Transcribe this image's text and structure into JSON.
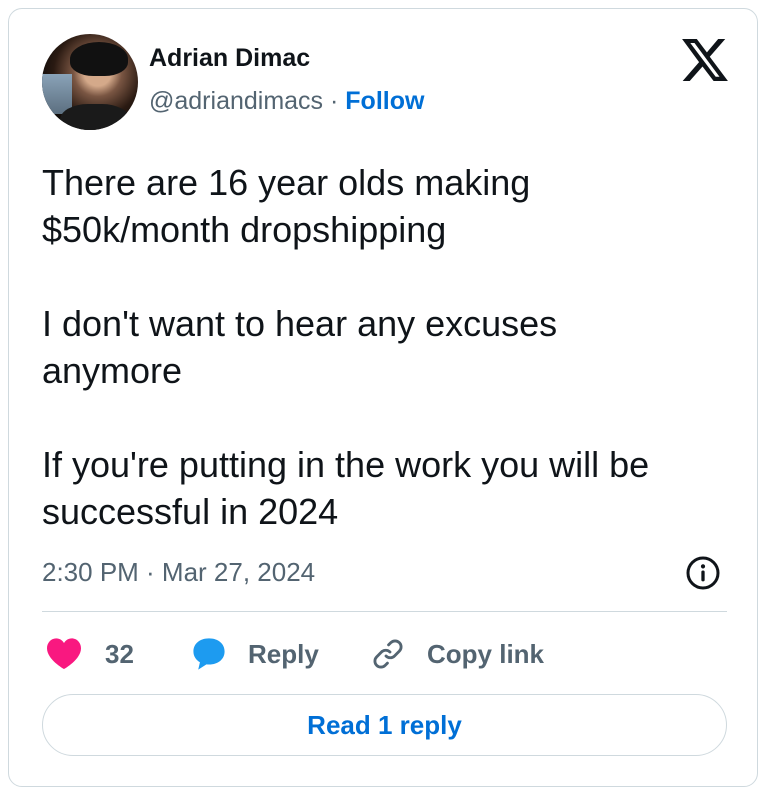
{
  "author": {
    "name": "Adrian Dimac",
    "handle": "@adriandimacs",
    "separator": " · ",
    "follow_label": "Follow"
  },
  "tweet": {
    "text": "There are 16 year olds making\n$50k/month dropshipping\n\nI don't want to hear any excuses\nanymore\n\nIf you're putting in the work you will be\nsuccessful in 2024",
    "timestamp": "2:30 PM · Mar 27, 2024"
  },
  "actions": {
    "like_count": "32",
    "reply_label": "Reply",
    "copy_link_label": "Copy link"
  },
  "read_replies_label": "Read 1 reply",
  "icons": {
    "brand": "x-logo-icon",
    "info": "info-icon",
    "like": "heart-icon",
    "reply": "speech-bubble-icon",
    "copy": "link-icon"
  },
  "colors": {
    "text": "#0f1419",
    "secondary": "#536471",
    "link": "#006fd6",
    "heart": "#f91880",
    "reply_bubble": "#1d9bf0",
    "border": "#cfd9de"
  }
}
